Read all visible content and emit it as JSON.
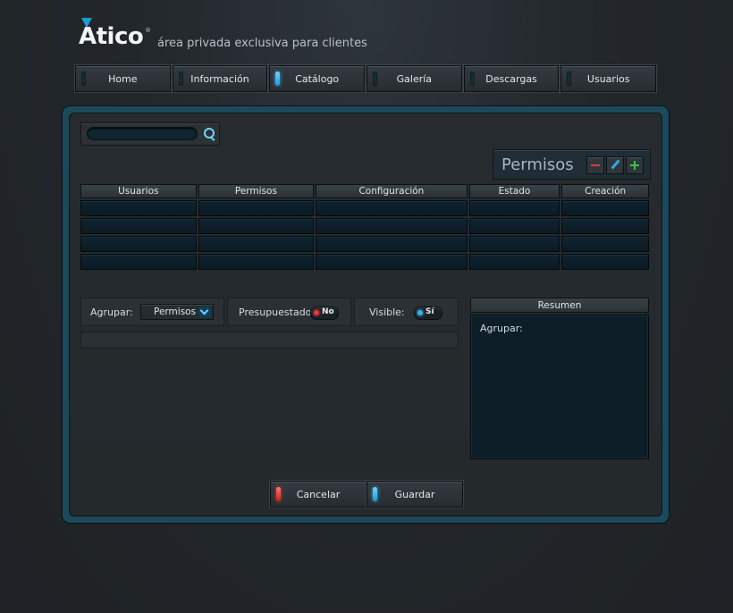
{
  "brand": {
    "logo_text": "Atico",
    "logo_mark": "®",
    "tagline": "área privada exclusiva para clientes",
    "accent": "#1e9ad6"
  },
  "nav": {
    "items": [
      {
        "label": "Home",
        "active": false
      },
      {
        "label": "Información",
        "active": false
      },
      {
        "label": "Catálogo",
        "active": true
      },
      {
        "label": "Galería",
        "active": false
      },
      {
        "label": "Descargas",
        "active": false
      },
      {
        "label": "Usuarios",
        "active": false
      }
    ]
  },
  "search": {
    "value": "",
    "icon": "search-icon"
  },
  "section": {
    "title": "Permisos",
    "actions": [
      "remove-icon",
      "edit-icon",
      "add-icon"
    ]
  },
  "table": {
    "columns": [
      "Usuarios",
      "Permisos",
      "Configuración",
      "Estado",
      "Creación"
    ],
    "rows": [
      [
        "",
        "",
        "",
        "",
        ""
      ],
      [
        "",
        "",
        "",
        "",
        ""
      ],
      [
        "",
        "",
        "",
        "",
        ""
      ],
      [
        "",
        "",
        "",
        "",
        ""
      ]
    ]
  },
  "filters": {
    "group_label": "Agrupar:",
    "group_value": "Permisos",
    "budget_label": "Presupuestado:",
    "budget_value": "No",
    "visible_label": "Visible:",
    "visible_value": "Sí"
  },
  "summary": {
    "title": "Resumen",
    "group_label": "Agrupar:"
  },
  "footer": {
    "cancel_label": "Cancelar",
    "save_label": "Guardar",
    "cancel_color": "#e03a3a",
    "save_color": "#2fb0ef"
  }
}
